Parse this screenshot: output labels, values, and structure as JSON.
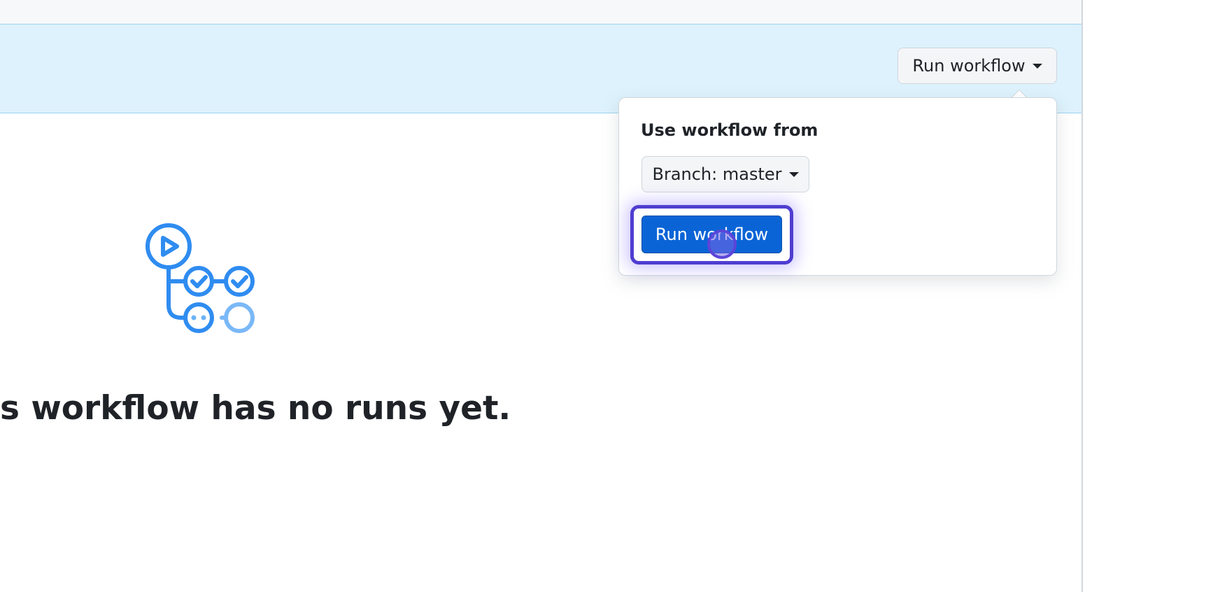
{
  "banner": {
    "run_toggle_label": "Run workflow"
  },
  "popover": {
    "title": "Use workflow from",
    "branch_label": "Branch: master",
    "submit_label": "Run workflow"
  },
  "empty_state": {
    "title": "s workflow has no runs yet."
  },
  "colors": {
    "accent": "#0b64d6",
    "banner_bg": "#ddf2fc",
    "highlight": "#4f3ed0",
    "icon_blue": "#2f8cf0"
  },
  "icons": {
    "empty_state": "workflow-graph-icon",
    "toggle_caret": "caret-down-icon",
    "branch_caret": "caret-down-icon"
  }
}
